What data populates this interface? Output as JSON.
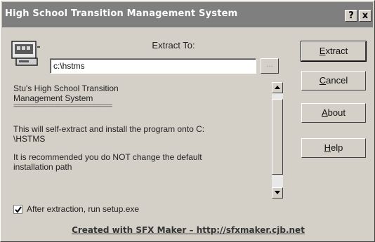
{
  "window": {
    "title": "High School Transition Management System",
    "help_button": "?",
    "close_button": "x"
  },
  "extract": {
    "label": "Extract To:",
    "path_value": "c:\\hstms",
    "browse_label": "..."
  },
  "message": {
    "title_line1": "Stu's High School Transition",
    "title_line2": "Management System",
    "separator": "=============================",
    "install_line1": "This will self-extract and install the program onto C:",
    "install_line2": "\\HSTMS",
    "recommend_line1": "It is recommended you do NOT change the default",
    "recommend_line2": "installation path"
  },
  "buttons": {
    "extract": {
      "first": "E",
      "rest": "xtract"
    },
    "cancel": {
      "first": "C",
      "rest": "ancel"
    },
    "about": {
      "first": "A",
      "rest": "bout"
    },
    "help": {
      "first": "H",
      "rest": "elp"
    }
  },
  "checkbox": {
    "label": "After extraction,  run  setup.exe",
    "checked": true
  },
  "footer": {
    "link_text": "Created with SFX Maker  –  http://sfxmaker.cjb.net"
  },
  "icons": {
    "app": "installer-computer-icon",
    "scroll_up": "arrow-up-icon",
    "scroll_down": "arrow-down-icon",
    "check": "checkmark-icon"
  }
}
